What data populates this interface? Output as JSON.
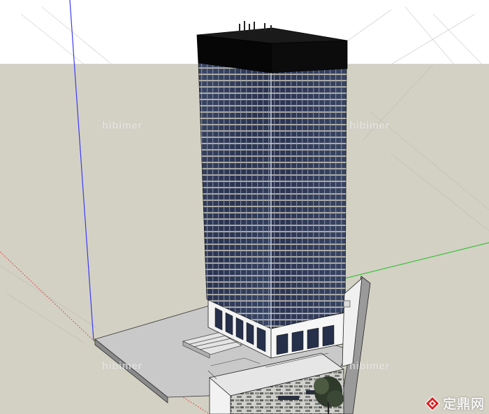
{
  "viewport": {
    "sky_color": "#ffffff",
    "ground_color": "#d3d1c4",
    "axis_colors": {
      "blue": "#3a3af2",
      "green": "#3cc23c",
      "red": "#d85050"
    },
    "building_glass_color": "#2f3a55",
    "roof_color": "#050505"
  },
  "watermarks": [
    "hibimer",
    "hibimer",
    "hibimer",
    "hibimer"
  ],
  "brand": {
    "text": "定鼎网",
    "icon": "ding-logo-icon",
    "color": "#e02020"
  }
}
